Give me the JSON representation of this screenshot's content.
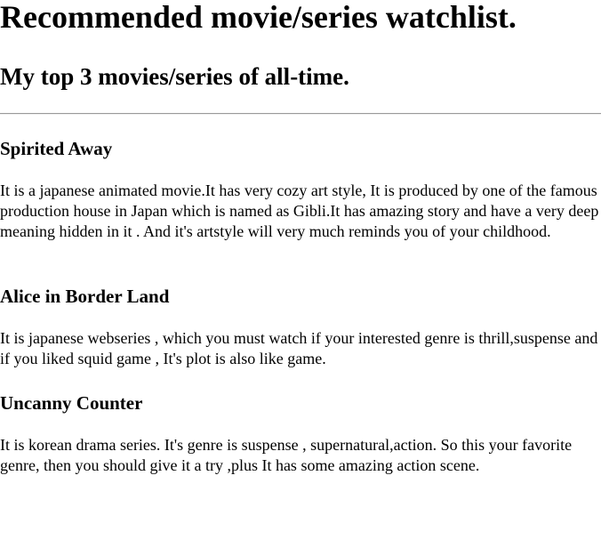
{
  "page": {
    "title": "Recommended movie/series watchlist.",
    "subtitle": "My top 3 movies/series of all-time."
  },
  "entries": [
    {
      "title": "Spirited Away",
      "description": "It is a japanese animated movie.It has very cozy art style, It is produced by one of the famous production house in Japan which is named as Gibli.It has amazing story and have a very deep meaning hidden in it . And it's artstyle will very much reminds you of your childhood."
    },
    {
      "title": "Alice in Border Land",
      "description": "It is japanese webseries , which you must watch if your interested genre is thrill,suspense and if you liked squid game , It's plot is also like game."
    },
    {
      "title": "Uncanny Counter",
      "description": "It is korean drama series. It's genre is suspense , supernatural,action. So this your favorite genre, then you should give it a try ,plus It has some amazing action scene."
    }
  ]
}
